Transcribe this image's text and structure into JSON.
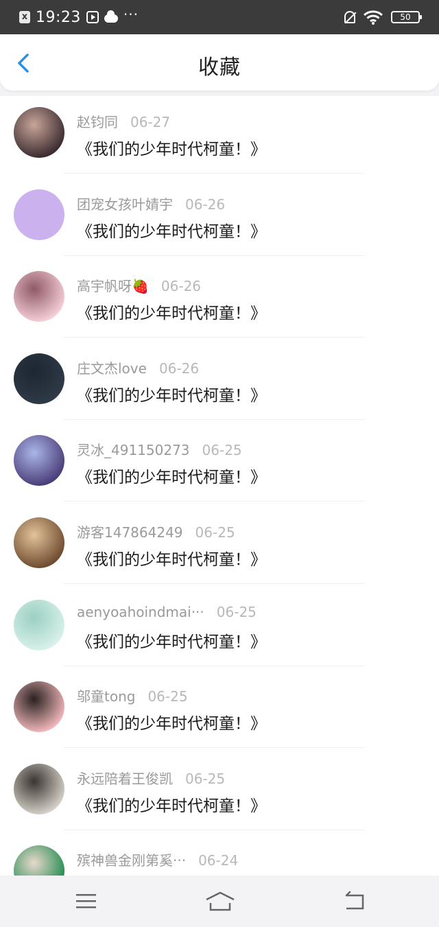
{
  "status_bar": {
    "time": "19:23",
    "x_badge": "x",
    "more": "···",
    "battery": "50"
  },
  "header": {
    "title": "收藏"
  },
  "items": [
    {
      "name": "赵钧同",
      "date": "06-27",
      "title": "《我们的少年时代柯童！》",
      "avatar_colors": [
        "#3a2a2e",
        "#c9a59a"
      ]
    },
    {
      "name": "团宠女孩叶婧宇",
      "date": "06-26",
      "title": "《我们的少年时代柯童！》",
      "avatar_colors": [
        "#cbb1ee",
        "#cbb1ee"
      ]
    },
    {
      "name": "高宇帆呀🍓",
      "date": "06-26",
      "title": "《我们的少年时代柯童！》",
      "avatar_colors": [
        "#f6cfd8",
        "#8e5a66"
      ]
    },
    {
      "name": "庄文杰love",
      "date": "06-26",
      "title": "《我们的少年时代柯童！》",
      "avatar_colors": [
        "#2f3a48",
        "#1d2632"
      ]
    },
    {
      "name": "灵冰_491150273",
      "date": "06-25",
      "title": "《我们的少年时代柯童！》",
      "avatar_colors": [
        "#4a3c78",
        "#aab6e8"
      ]
    },
    {
      "name": "游客147864249",
      "date": "06-25",
      "title": "《我们的少年时代柯童！》",
      "avatar_colors": [
        "#6e4a2e",
        "#e2c39a"
      ]
    },
    {
      "name": "aenyoahoindmai···",
      "date": "06-25",
      "title": "《我们的少年时代柯童！》",
      "avatar_colors": [
        "#d8f1ea",
        "#9ccfc2"
      ]
    },
    {
      "name": "邬童tong",
      "date": "06-25",
      "title": "《我们的少年时代柯童！》",
      "avatar_colors": [
        "#f2b8bc",
        "#2b2220"
      ]
    },
    {
      "name": "永远陪着王俊凯",
      "date": "06-25",
      "title": "《我们的少年时代柯童！》",
      "avatar_colors": [
        "#d6d1c8",
        "#3a3530"
      ]
    },
    {
      "name": "殡神兽金刚第奚···",
      "date": "06-24",
      "title": "《我们的少年时代柯童！》",
      "avatar_colors": [
        "#1e8a4c",
        "#e8d8cc"
      ]
    }
  ],
  "colors": {
    "accent": "#2b8fe3",
    "status_bar": "#3b3b3b"
  }
}
